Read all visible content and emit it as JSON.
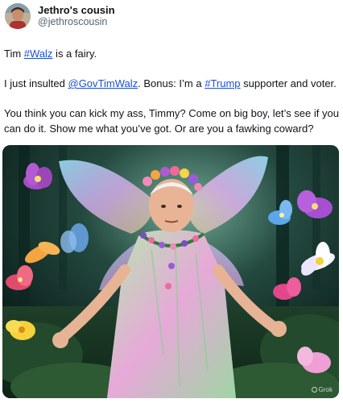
{
  "user": {
    "display_name": "Jethro's cousin",
    "handle": "@jethroscousin"
  },
  "tweet": {
    "line1_prefix": "Tim ",
    "line1_hashtag": "#Walz",
    "line1_suffix": " is a fairy.",
    "line2_prefix": "I just insulted ",
    "line2_mention": "@GovTimWalz",
    "line2_middle": ". Bonus: I’m a ",
    "line2_hashtag": "#Trump",
    "line2_suffix": " supporter and voter.",
    "line3": "You think you can kick my ass, Timmy? Come on big boy, let’s see if you can do it. Show me what you’ve got. Or are you a fawking coward?"
  },
  "media": {
    "watermark": "Grok"
  },
  "colors": {
    "link": "#1d4ed8",
    "text": "#0f1419",
    "secondary": "#536471"
  }
}
